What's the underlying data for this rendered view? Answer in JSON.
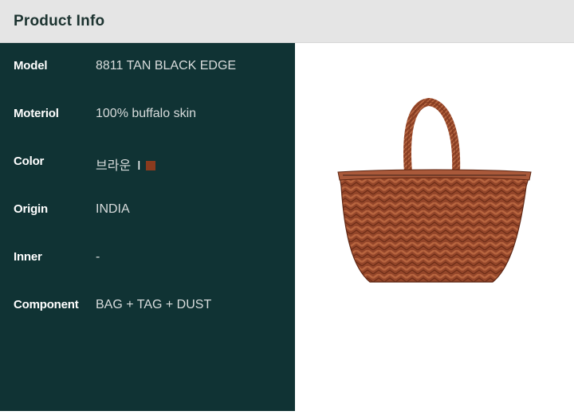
{
  "header": {
    "title": "Product Info"
  },
  "specs": [
    {
      "label": "Model",
      "value": "8811 TAN BLACK EDGE"
    },
    {
      "label": "Moteriol",
      "value": "100% buffalo skin"
    },
    {
      "label": "Color",
      "value": "브라운"
    },
    {
      "label": "Origin",
      "value": "INDIA"
    },
    {
      "label": "Inner",
      "value": "-"
    },
    {
      "label": "Component",
      "value": "BAG + TAG + DUST"
    }
  ],
  "color_swatch": {
    "separator": "I",
    "hex": "#8a3b1e"
  },
  "colors": {
    "panel": "#103334",
    "header": "#e5e5e5",
    "title": "#1d3431",
    "leather": "#9a4a2a"
  },
  "product_image": {
    "icon": "woven-leather-basket-bag"
  }
}
